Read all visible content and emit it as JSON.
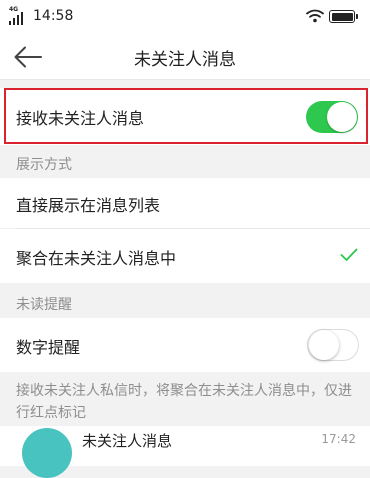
{
  "status_bar": {
    "network": "4G",
    "time": "14:58"
  },
  "nav": {
    "title": "未关注人消息"
  },
  "receive": {
    "label": "接收未关注人消息",
    "enabled": true
  },
  "display_mode": {
    "header": "展示方式",
    "options": [
      {
        "label": "直接展示在消息列表",
        "selected": false
      },
      {
        "label": "聚合在未关注人消息中",
        "selected": true
      }
    ]
  },
  "unread": {
    "header": "未读提醒",
    "number_badge_label": "数字提醒",
    "number_badge_enabled": false
  },
  "footnote": "接收未关注人私信时，将聚合在未关注人消息中，仅进行红点标记",
  "preview": {
    "title": "未关注人消息",
    "time": "17:42"
  },
  "colors": {
    "toggle_on": "#2dc84d",
    "check": "#2dc84d",
    "highlight": "#d9232d",
    "avatar": "#49c3c0"
  }
}
